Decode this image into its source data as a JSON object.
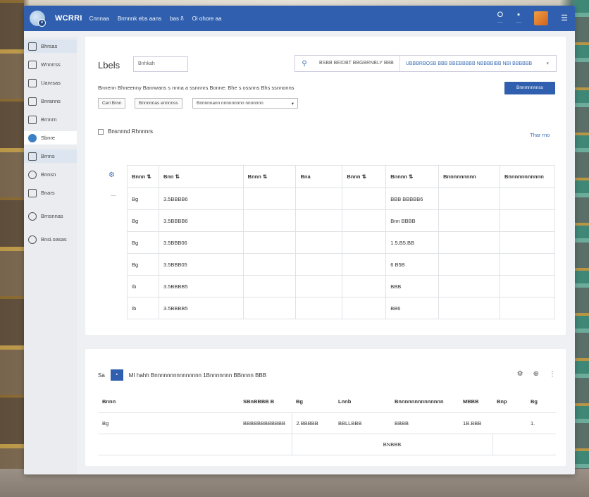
{
  "app": {
    "brand": "WCRRI",
    "nav": [
      "Cnnnaa",
      "Brmnnk ebs aans",
      "bas  ñ",
      "Oi ohore  aa"
    ]
  },
  "topbar": {
    "icon1_label": "O",
    "icon2_label": "▪",
    "menu_glyph": "☰"
  },
  "sidebar": {
    "items": [
      {
        "label": "Bhrsas"
      },
      {
        "label": "Wnnrrss"
      },
      {
        "label": "Uanrsas"
      },
      {
        "label": "Bnranns"
      },
      {
        "label": "Brnnrn"
      },
      {
        "label": "Sbnre"
      },
      {
        "label": "Brnns"
      },
      {
        "label": "Bnnsn"
      },
      {
        "label": "Bnars"
      },
      {
        "label": "Brnsnnas"
      },
      {
        "label": "Bnsi.oasas"
      }
    ]
  },
  "card1": {
    "title": "Lbels",
    "input_value": "Bnhkah",
    "picker_left": "BSBB BEIDBT BBGBRNBLY BBB",
    "picker_right": "UBBBRBOSB BBB  BBEBBBBB  NBBBBIBB NBI BBBBBB",
    "filter_text": "Bnnenn Bhneenny Banrwans s nnna a ssnnnrs Bonne: Bhe s ossnns Bhs ssnnonns",
    "primary_button": "Bnnmnnnnss",
    "chips": [
      "Ceri Brnn",
      "Bnnnnnas ennnnss"
    ],
    "select_value": "Bnnnnnann nnnnnnnnn nnnnnnn",
    "checkbox_label": "Bnsnnnd Rhnnnrs",
    "right_link": "Thar rno",
    "table": {
      "headers": [
        "Bnnn ⇅",
        "Bnn ⇅",
        "Bnnn ⇅",
        "Bna",
        "Bnnn ⇅",
        "Bnnnn ⇅",
        "Bnnnnnnnnn",
        "Bnnnnnnnnnnn"
      ],
      "rows": [
        [
          "Bg",
          "3.5BBBB6",
          "",
          "",
          "",
          "BBB  BBBBB6",
          "",
          ""
        ],
        [
          "Bg",
          "3.5BBBB6",
          "",
          "",
          "",
          "Bnn  BBBB",
          "",
          ""
        ],
        [
          "Bg",
          "3.5BBB06",
          "",
          "",
          "",
          "1.5.B5.BB",
          "",
          ""
        ],
        [
          "Bg",
          "3.5BBB05",
          "",
          "",
          "",
          "6 B5B",
          "",
          ""
        ],
        [
          "Ib",
          "3.5BBBB5",
          "",
          "",
          "",
          "BBB",
          "",
          ""
        ],
        [
          "Ib",
          "3.5BBBB5",
          "",
          "",
          "",
          "BB6",
          "",
          ""
        ]
      ]
    }
  },
  "card2": {
    "left_glyph": "Sa",
    "box_label": "▪",
    "title": "MI hahh Bnnnnnnnnnnnnnnn  1Bnnnnnnn BBnnnn  BBB",
    "headers": [
      "Bnnn",
      "SBnBBBB B",
      "Bg",
      "Lnnb",
      "Bnnnnnnnnnnnnnn",
      "MBBB",
      "Bnp",
      "Bg"
    ],
    "row": [
      "Bg",
      "BBBBBBBBBBBB",
      "2.BBBBB",
      "BBLLBBB",
      "BBBB",
      "1B.BBB",
      "",
      "1."
    ],
    "footer_link": "BNBBB"
  }
}
